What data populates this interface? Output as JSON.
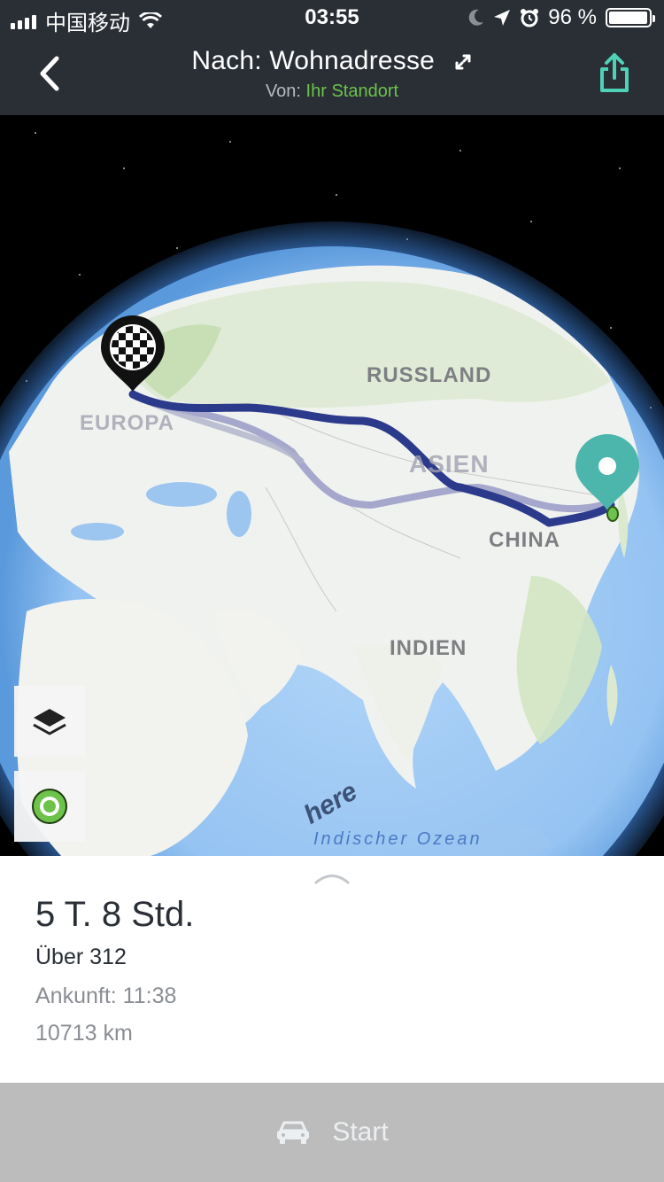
{
  "status_bar": {
    "carrier": "中国移动",
    "time": "03:55",
    "battery": "96 %"
  },
  "header": {
    "title": "Nach: Wohnadresse",
    "from_label": "Von:",
    "from_value": "Ihr Standort",
    "accent_color": "#6cc24a",
    "share_icon": "share-icon",
    "back_icon": "chevron-left-icon"
  },
  "map": {
    "labels": {
      "russia": "RUSSLAND",
      "europe": "EUROPA",
      "asia": "ASIEN",
      "china": "CHINA",
      "india": "INDIEN",
      "ocean": "Indischer Ozean"
    },
    "logo": "here",
    "route_color": "#2c3a8c",
    "alt_route_color": "#9ca0c8",
    "destination_icon": "checkered-flag-pin-icon",
    "origin_icon": "location-pin-icon"
  },
  "route": {
    "duration": "5 T. 8 Std.",
    "via": "Über 312",
    "arrival": "Ankunft: 11:38",
    "distance": "10713 km"
  },
  "footer": {
    "start_label": "Start",
    "icon": "car-icon"
  }
}
